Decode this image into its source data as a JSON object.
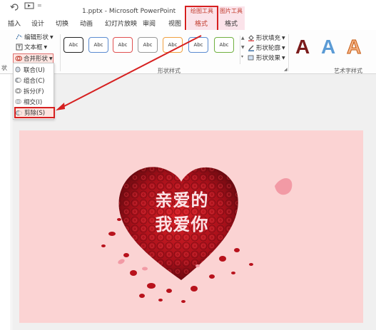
{
  "window": {
    "title": "1.pptx - Microsoft PowerPoint"
  },
  "context_tabs": {
    "drawing_tools": "绘图工具",
    "picture_tools": "图片工具"
  },
  "tabs": [
    "插入",
    "设计",
    "切换",
    "动画",
    "幻灯片放映",
    "审阅",
    "视图",
    "格式",
    "格式"
  ],
  "ribbon": {
    "edit_shape": "编辑形状",
    "text_box": "文本框",
    "merge_shapes": "合并形状",
    "shape_styles": [
      "Abc",
      "Abc",
      "Abc",
      "Abc",
      "Abc",
      "Abc",
      "Abc"
    ],
    "shape_fill": "形状填充",
    "shape_outline": "形状轮廓",
    "shape_effects": "形状效果",
    "group_shape_styles": "形状样式",
    "group_wordart_styles": "艺术字样式",
    "group_left_fragment": "状",
    "wordart_letters": [
      "A",
      "A",
      "A"
    ]
  },
  "dropdown": {
    "items": [
      {
        "label": "联合(U)",
        "icon": "union-icon"
      },
      {
        "label": "组合(C)",
        "icon": "combine-icon"
      },
      {
        "label": "拆分(F)",
        "icon": "fragment-icon"
      },
      {
        "label": "相交(I)",
        "icon": "intersect-icon"
      },
      {
        "label": "剪除(S)",
        "icon": "subtract-icon"
      }
    ]
  },
  "slide": {
    "text_line1": "亲爱的",
    "text_line2": "我爱你"
  },
  "colors": {
    "accent_red": "#d62020",
    "slide_bg": "#fbd3d3",
    "heart_red": "#b0101a",
    "context_tab": "#c0392b"
  }
}
